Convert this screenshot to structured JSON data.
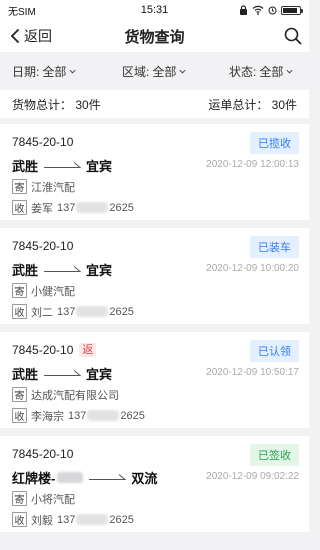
{
  "statusbar": {
    "carrier": "无SIM",
    "time": "15:31"
  },
  "navbar": {
    "back_label": "返回",
    "title": "货物查询"
  },
  "filters": [
    {
      "label": "日期:",
      "value": "全部"
    },
    {
      "label": "区域:",
      "value": "全部"
    },
    {
      "label": "状态:",
      "value": "全部"
    }
  ],
  "totals": {
    "goods": "货物总计： 30件",
    "waybill": "运单总计： 30件"
  },
  "orders": [
    {
      "code": "7845-20-10",
      "returned": false,
      "status": "已揽收",
      "status_color": "blue",
      "from": "武胜",
      "to": "宜宾",
      "time": "2020-12-09 12:00:13",
      "send_tag": "寄",
      "sender": "江淮汽配",
      "recv_tag": "收",
      "receiver": "姜军",
      "phone_start": "137",
      "phone_end": "2625"
    },
    {
      "code": "7845-20-10",
      "returned": false,
      "status": "已装车",
      "status_color": "blue",
      "from": "武胜",
      "to": "宜宾",
      "time": "2020-12-09 10:00:20",
      "send_tag": "寄",
      "sender": "小健汽配",
      "recv_tag": "收",
      "receiver": "刘二",
      "phone_start": "137",
      "phone_end": "2625"
    },
    {
      "code": "7845-20-10",
      "returned": true,
      "return_label": "返",
      "status": "已认领",
      "status_color": "blue",
      "from": "武胜",
      "to": "宜宾",
      "time": "2020-12-09 10:50:17",
      "send_tag": "寄",
      "sender": "达成汽配有限公司",
      "recv_tag": "收",
      "receiver": "李海宗",
      "phone_start": "137",
      "phone_end": "2625"
    },
    {
      "code": "7845-20-10",
      "returned": false,
      "status": "已签收",
      "status_color": "green",
      "from": "红牌楼-",
      "to": "双流",
      "time": "2020-12-09 09:02:22",
      "send_tag": "寄",
      "sender": "小将汽配",
      "recv_tag": "收",
      "receiver": "刘毅",
      "phone_start": "137",
      "phone_end": "2625"
    }
  ]
}
